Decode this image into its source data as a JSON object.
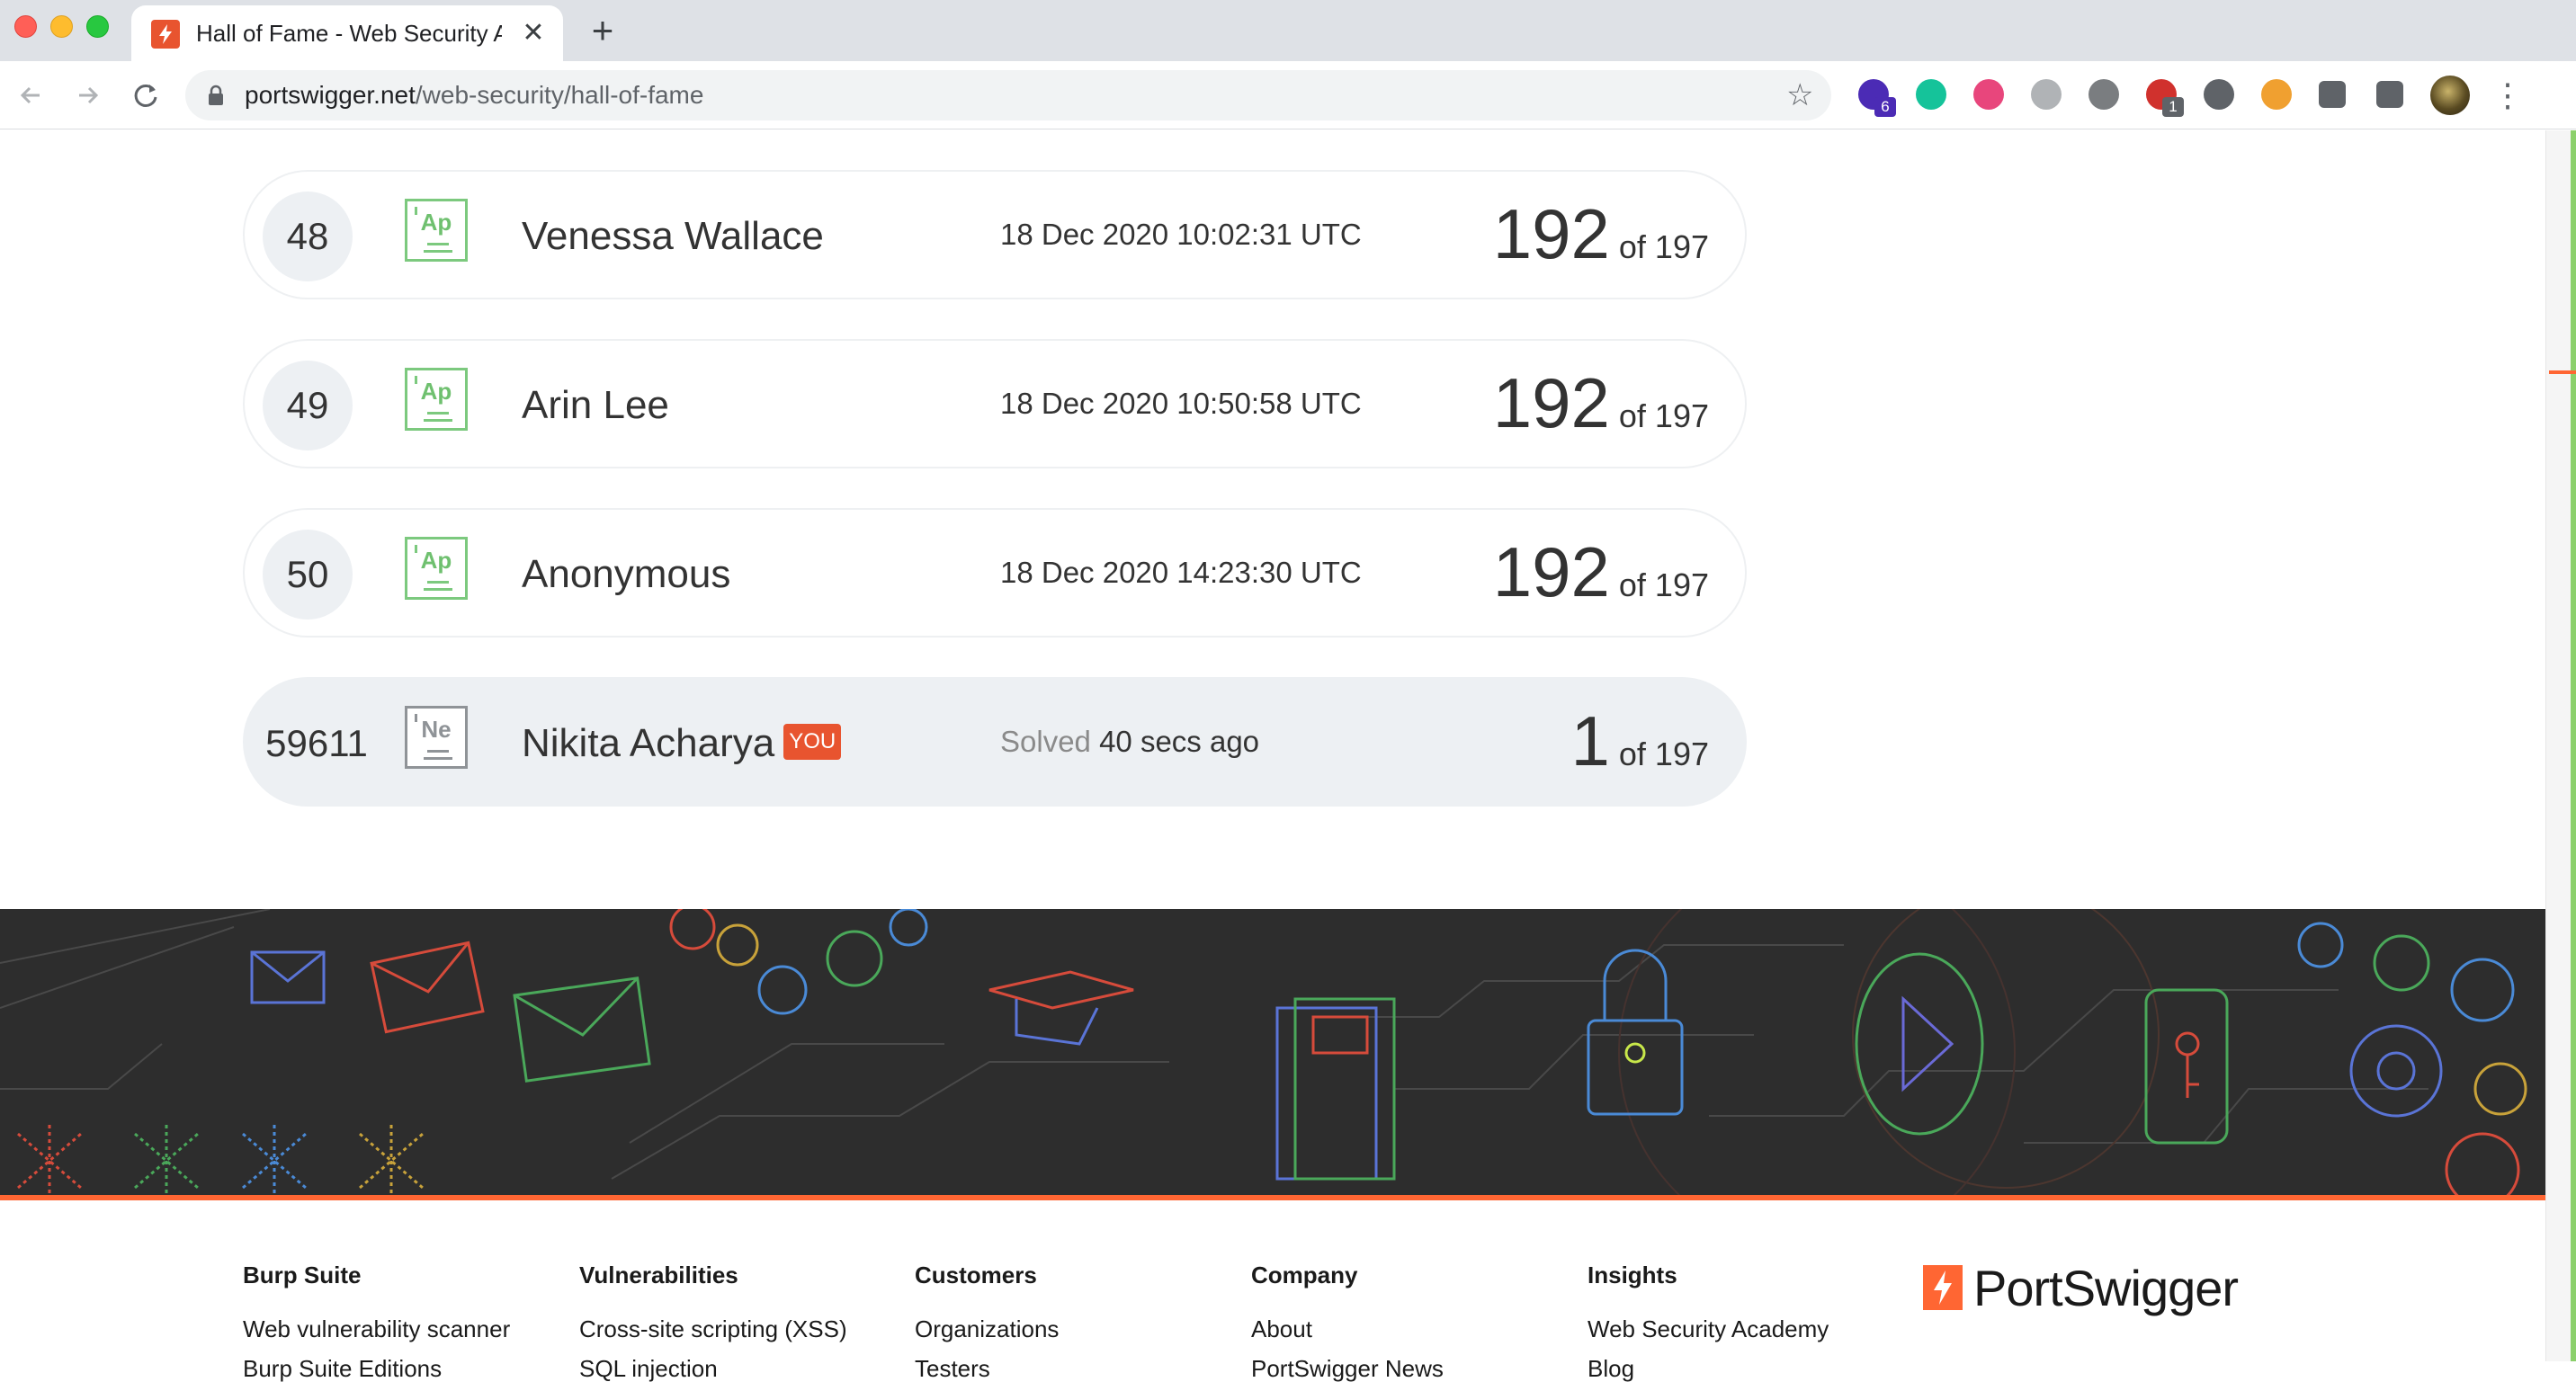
{
  "browser": {
    "tab_title": "Hall of Fame - Web Security Academy",
    "tab_close": "✕",
    "new_tab": "+",
    "url_host": "portswigger.net",
    "url_path": "/web-security/hall-of-fame",
    "extensions": [
      {
        "name": "academy-cap-extension",
        "color": "#4b2bb5",
        "badge": "6",
        "badge_color": "#4b2bb5"
      },
      {
        "name": "grammarly-extension",
        "color": "#15c39a",
        "badge": "",
        "badge_color": ""
      },
      {
        "name": "red-circle-extension",
        "color": "#e8467c",
        "badge": "",
        "badge_color": ""
      },
      {
        "name": "chat-bubble-extension",
        "color": "#b0b3b6",
        "badge": "",
        "badge_color": ""
      },
      {
        "name": "gray-circle-extension",
        "color": "#7a7d80",
        "badge": "",
        "badge_color": ""
      },
      {
        "name": "adblock-extension",
        "color": "#d0312d",
        "badge": "1",
        "badge_color": "#5f6368"
      },
      {
        "name": "facebook-extension",
        "color": "#5f6368",
        "badge": "",
        "badge_color": ""
      },
      {
        "name": "image-extension",
        "color": "#f0a030",
        "badge": "",
        "badge_color": ""
      },
      {
        "name": "puzzle-extensions-icon",
        "color": "#5f6368",
        "badge": "",
        "badge_color": ""
      },
      {
        "name": "media-queue-icon",
        "color": "#5f6368",
        "badge": "",
        "badge_color": ""
      }
    ]
  },
  "leaderboard": {
    "rows": [
      {
        "rank": "48",
        "level": "Ap",
        "name": "Venessa Wallace",
        "date": "18 Dec 2020 10:02:31 UTC",
        "score": "192",
        "of": "of 197"
      },
      {
        "rank": "49",
        "level": "Ap",
        "name": "Arin Lee",
        "date": "18 Dec 2020 10:50:58 UTC",
        "score": "192",
        "of": "of 197"
      },
      {
        "rank": "50",
        "level": "Ap",
        "name": "Anonymous",
        "date": "18 Dec 2020 14:23:30 UTC",
        "score": "192",
        "of": "of 197"
      }
    ],
    "you": {
      "rank": "59611",
      "level": "Ne",
      "name": "Nikita Acharya",
      "badge": "YOU",
      "solved_label": "Solved",
      "solved_time": "40 secs ago",
      "score": "1",
      "of": "of 197"
    }
  },
  "colors": {
    "accent": "#ff6633",
    "practitioner": "#7cc97e",
    "banner_bg": "#2d2d2d"
  },
  "footer": {
    "columns": [
      {
        "heading": "Burp Suite",
        "links": [
          "Web vulnerability scanner",
          "Burp Suite Editions"
        ]
      },
      {
        "heading": "Vulnerabilities",
        "links": [
          "Cross-site scripting (XSS)",
          "SQL injection"
        ]
      },
      {
        "heading": "Customers",
        "links": [
          "Organizations",
          "Testers"
        ]
      },
      {
        "heading": "Company",
        "links": [
          "About",
          "PortSwigger News"
        ]
      },
      {
        "heading": "Insights",
        "links": [
          "Web Security Academy",
          "Blog"
        ]
      }
    ],
    "logo_text": "PortSwigger"
  }
}
